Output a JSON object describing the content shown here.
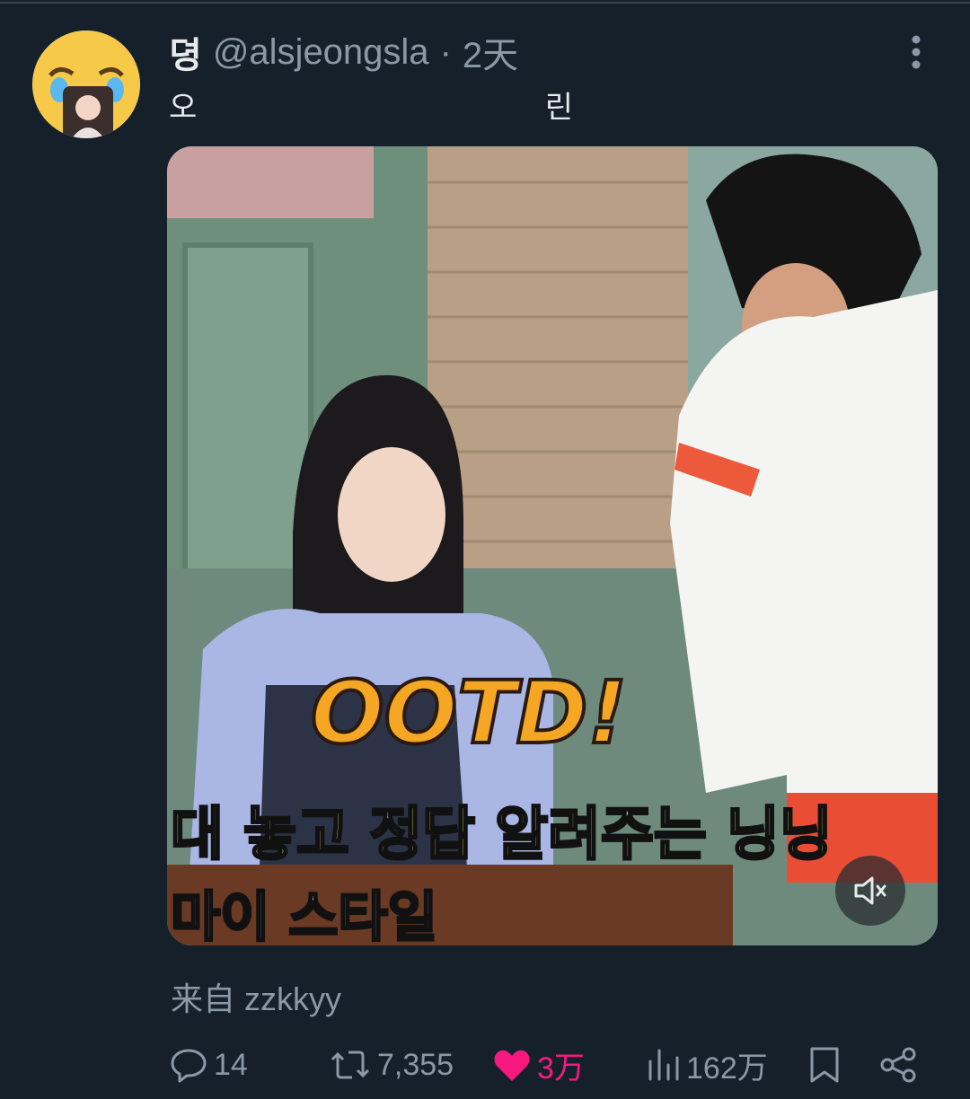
{
  "tweet": {
    "display_name": "뎡",
    "handle": "@alsjeongsla",
    "separator": "·",
    "time": "2天",
    "text_start": "오",
    "text_end": "린",
    "source": "来自 zzkkyy"
  },
  "video": {
    "caption_big": "OOTD!",
    "subtitle_line1": "대 놓고 정답 알려주는 닝닝",
    "subtitle_line2": "마이 스타일",
    "muted": true
  },
  "actions": {
    "replies": "14",
    "retweets": "7,355",
    "likes": "3万",
    "views": "162万"
  },
  "colors": {
    "background": "#15202b",
    "like": "#f91880",
    "muted_text": "#8b98a5"
  },
  "icons": [
    "more-vertical-icon",
    "mute-icon",
    "reply-icon",
    "retweet-icon",
    "heart-icon",
    "views-icon",
    "bookmark-icon",
    "share-icon"
  ]
}
